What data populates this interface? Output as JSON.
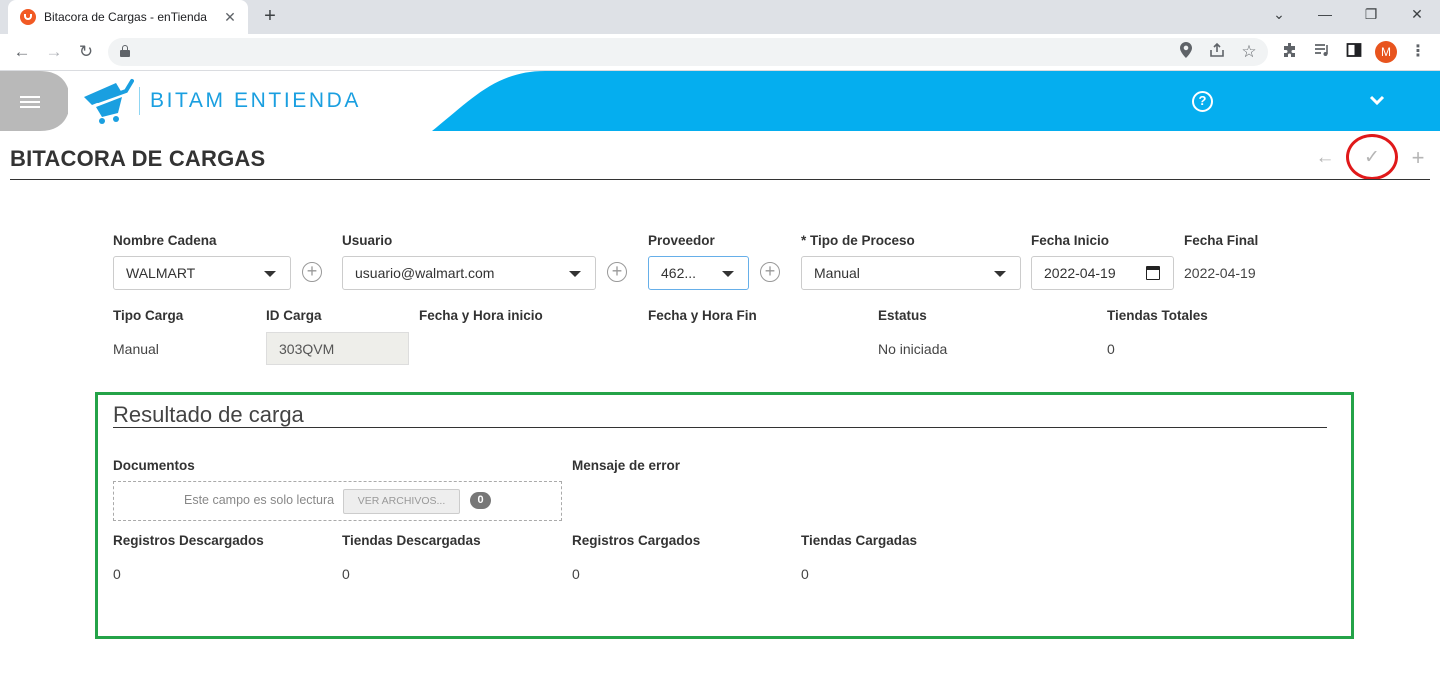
{
  "browser": {
    "tab_title": "Bitacora de Cargas - enTienda",
    "tab_close": "✕",
    "new_tab": "+",
    "window_controls": [
      "⌄",
      "—",
      "❐",
      "✕"
    ]
  },
  "app": {
    "brand": "BITAM ENTIENDA",
    "colors": {
      "header": "#05aeef",
      "menu_button": "#b9b9b9",
      "highlight_frame": "#24a348",
      "annotation_circle": "#e0191a"
    }
  },
  "page": {
    "title": "BITACORA DE CARGAS",
    "actions": {
      "back": "←",
      "save": "✓",
      "add": "+"
    }
  },
  "form": {
    "nombre_cadena": {
      "label": "Nombre Cadena",
      "value": "WALMART"
    },
    "usuario": {
      "label": "Usuario",
      "value": "usuario@walmart.com"
    },
    "proveedor": {
      "label": "Proveedor",
      "value": "462..."
    },
    "tipo_proceso": {
      "label": "* Tipo de Proceso",
      "value": "Manual"
    },
    "fecha_inicio": {
      "label": "Fecha Inicio",
      "value": "2022-04-19"
    },
    "fecha_final": {
      "label": "Fecha Final",
      "value": "2022-04-19"
    },
    "tipo_carga": {
      "label": "Tipo Carga",
      "value": "Manual"
    },
    "id_carga": {
      "label": "ID Carga",
      "value": "303QVM"
    },
    "fecha_hora_inicio": {
      "label": "Fecha y Hora inicio",
      "value": ""
    },
    "fecha_hora_fin": {
      "label": "Fecha y Hora Fin",
      "value": ""
    },
    "estatus": {
      "label": "Estatus",
      "value": "No iniciada"
    },
    "tiendas_totales": {
      "label": "Tiendas Totales",
      "value": "0"
    }
  },
  "resultado": {
    "title": "Resultado de carga",
    "documentos": {
      "label": "Documentos",
      "placeholder": "Este campo es solo lectura",
      "button": "VER ARCHIVOS...",
      "count": "0"
    },
    "mensaje_error": {
      "label": "Mensaje de error"
    },
    "registros_descargados": {
      "label": "Registros Descargados",
      "value": "0"
    },
    "tiendas_descargadas": {
      "label": "Tiendas Descargadas",
      "value": "0"
    },
    "registros_cargados": {
      "label": "Registros Cargados",
      "value": "0"
    },
    "tiendas_cargadas": {
      "label": "Tiendas Cargadas",
      "value": "0"
    }
  },
  "icons": [
    "favicon-icon",
    "back-nav-icon",
    "forward-nav-icon",
    "reload-icon",
    "lock-icon",
    "location-icon",
    "share-icon",
    "star-icon",
    "extensions-icon",
    "reading-list-icon",
    "sidepanel-icon",
    "menu-dots-icon",
    "hamburger-icon",
    "cart-logo-icon",
    "help-icon",
    "chevron-down-icon",
    "calendar-icon",
    "add-circle-icon"
  ]
}
